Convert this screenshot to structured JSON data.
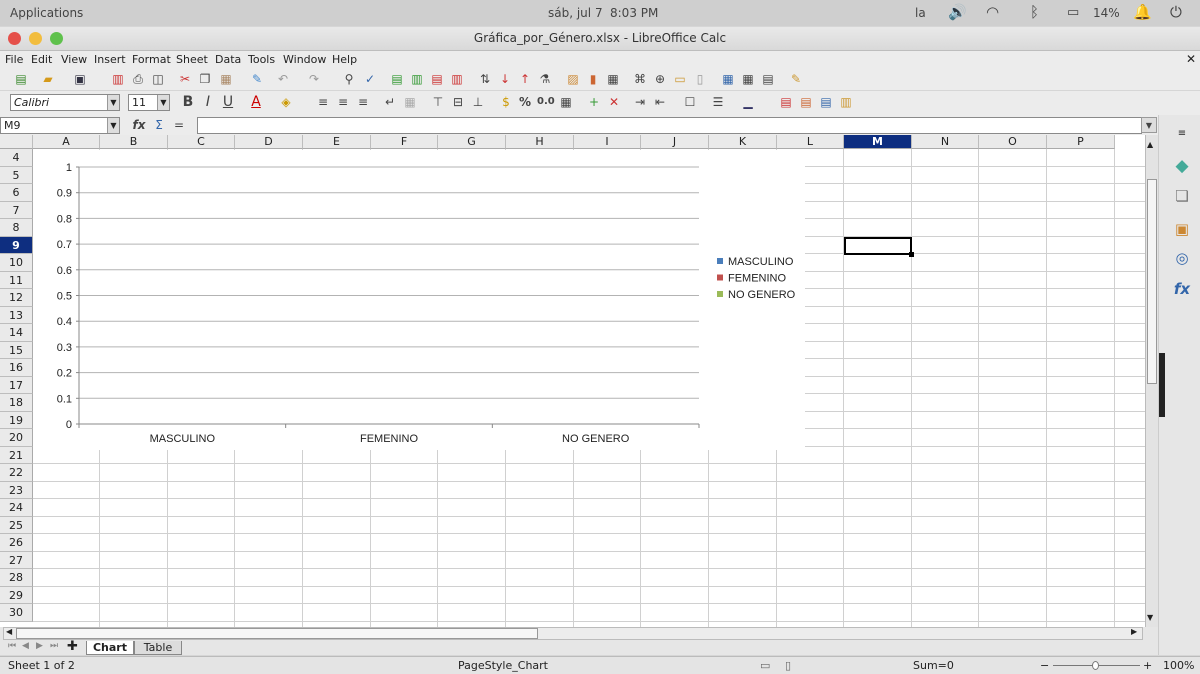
{
  "topbar": {
    "applications": "Applications",
    "date": "sáb, jul  7",
    "time": "8:03 PM",
    "keyboard": "la",
    "battery": "14%"
  },
  "window": {
    "title": "Gráfica_por_Género.xlsx - LibreOffice Calc"
  },
  "menu": [
    "File",
    "Edit",
    "View",
    "Insert",
    "Format",
    "Sheet",
    "Data",
    "Tools",
    "Window",
    "Help"
  ],
  "format": {
    "font_name": "Calibri",
    "font_size": "11"
  },
  "formula": {
    "name_box": "M9",
    "content": ""
  },
  "columns": [
    "A",
    "B",
    "C",
    "D",
    "E",
    "F",
    "G",
    "H",
    "I",
    "J",
    "K",
    "L",
    "M",
    "N",
    "O",
    "P"
  ],
  "rows": [
    "4",
    "5",
    "6",
    "7",
    "8",
    "9",
    "10",
    "11",
    "12",
    "13",
    "14",
    "15",
    "16",
    "17",
    "18",
    "19",
    "20",
    "21",
    "22",
    "23",
    "24",
    "25",
    "26",
    "27",
    "28",
    "29",
    "30"
  ],
  "selected": {
    "column": "M",
    "row": "9"
  },
  "chart_data": {
    "type": "bar",
    "categories": [
      "MASCULINO",
      "FEMENINO",
      "NO GENERO"
    ],
    "series": [
      {
        "name": "MASCULINO",
        "color": "#4a7ebb",
        "values": []
      },
      {
        "name": "FEMENINO",
        "color": "#c0504d",
        "values": []
      },
      {
        "name": "NO GENERO",
        "color": "#9bbb59",
        "values": []
      }
    ],
    "yticks": [
      "0",
      "0.1",
      "0.2",
      "0.3",
      "0.4",
      "0.5",
      "0.6",
      "0.7",
      "0.8",
      "0.9",
      "1"
    ],
    "ylim": [
      0,
      1
    ],
    "grid": true,
    "legend": "right"
  },
  "tabs": [
    {
      "label": "Chart",
      "active": true
    },
    {
      "label": "Table",
      "active": false
    }
  ],
  "status": {
    "sheet": "Sheet 1 of 2",
    "page_style": "PageStyle_Chart",
    "sum": "Sum=0",
    "zoom": "100%"
  }
}
